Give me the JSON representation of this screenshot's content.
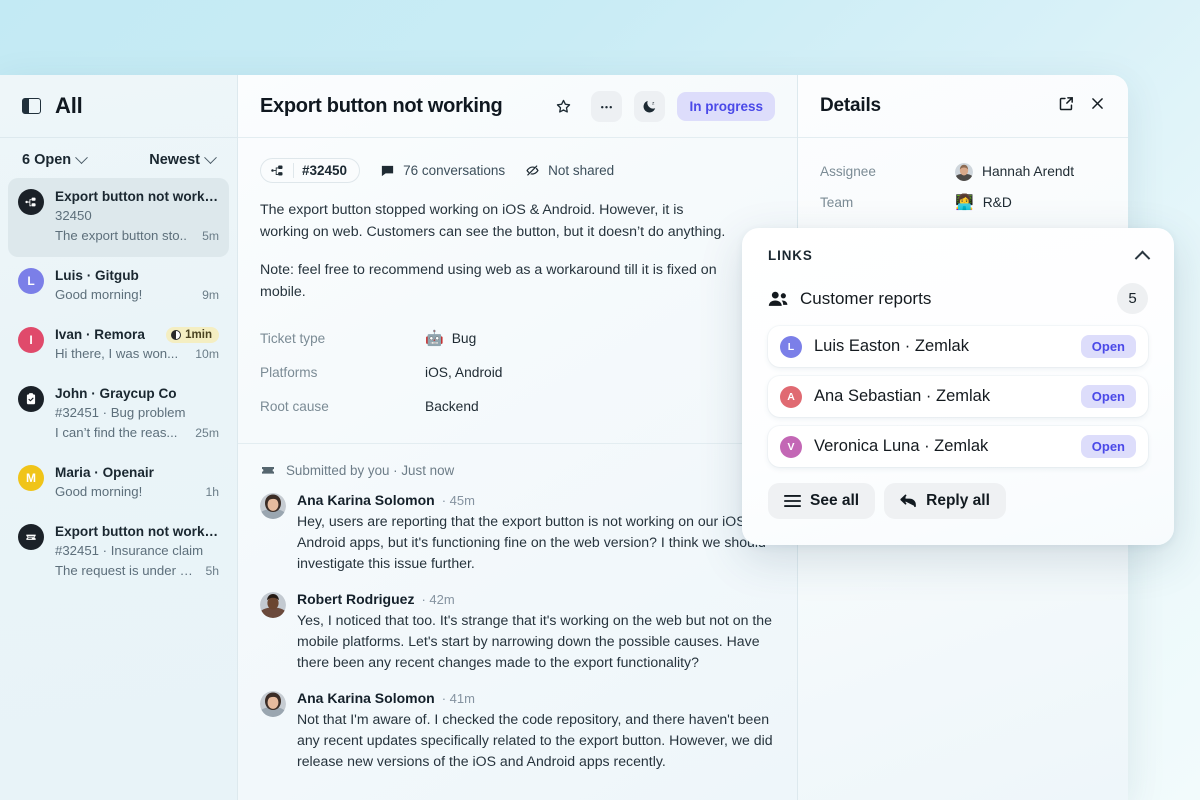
{
  "sidebar": {
    "toggle_icon": "panel-toggle-icon",
    "title": "All",
    "filter": {
      "label": "6 Open",
      "icon": "chevron-down-icon"
    },
    "sort": {
      "label": "Newest",
      "icon": "chevron-down-icon"
    },
    "items": [
      {
        "icon": "sitemap-icon",
        "avatar_type": "icon",
        "avatar_color": "#1b2128",
        "title": "Export button not working",
        "subtitle": "32450",
        "preview": "The export button sto..",
        "time": "5m",
        "active": true,
        "badge": null
      },
      {
        "avatar_type": "initial",
        "initial": "L",
        "avatar_color": "#7b7fe8",
        "title": "Luis · Gitgub",
        "subtitle": null,
        "preview": "Good morning!",
        "time": "9m",
        "active": false,
        "badge": null
      },
      {
        "avatar_type": "initial",
        "initial": "I",
        "avatar_color": "#e04a6b",
        "title": "Ivan · Remora",
        "subtitle": null,
        "preview": "Hi there, I was won...",
        "time": "10m",
        "active": false,
        "badge": "1min"
      },
      {
        "icon": "clipboard-check-icon",
        "avatar_type": "icon",
        "avatar_color": "#1b2128",
        "title": "John · Graycup Co",
        "subtitle": "#32451 · Bug problem",
        "preview": "I can’t find the reas...",
        "time": "25m",
        "active": false,
        "badge": null
      },
      {
        "avatar_type": "initial",
        "initial": "M",
        "avatar_color": "#f0c419",
        "title": "Maria · Openair",
        "subtitle": null,
        "preview": "Good morning!",
        "time": "1h",
        "active": false,
        "badge": null
      },
      {
        "icon": "ticket-icon",
        "avatar_type": "icon",
        "avatar_color": "#1b2128",
        "title": "Export button not working",
        "subtitle": "#32451 · Insurance claim",
        "preview": "The request is under way",
        "time": "5h",
        "active": false,
        "badge": null
      }
    ]
  },
  "main": {
    "title": "Export button not working",
    "actions": [
      {
        "name": "star-icon",
        "label": "Star"
      },
      {
        "name": "more-icon",
        "label": "More"
      },
      {
        "name": "snooze-moon-icon",
        "label": "Snooze"
      }
    ],
    "status": "In progress",
    "meta": {
      "ticket_icon": "sitemap-icon",
      "ticket_id": "#32450",
      "conversations_icon": "chat-icon",
      "conversations": "76 conversations",
      "shared_icon": "eye-off-icon",
      "shared": "Not shared"
    },
    "description": [
      "The export button stopped working on iOS & Android. However, it is working on web. Customers can see the button, but it doesn’t do anything.",
      "Note: feel free to recommend using web as a workaround till it is fixed on mobile."
    ],
    "attributes": [
      {
        "key": "Ticket type",
        "emoji": "🤖",
        "value": "Bug"
      },
      {
        "key": "Platforms",
        "emoji": "",
        "value": "iOS, Android"
      },
      {
        "key": "Root cause",
        "emoji": "",
        "value": "Backend"
      }
    ],
    "submitted": {
      "icon": "ticket-icon",
      "text": "Submitted by you · Just now"
    },
    "messages": [
      {
        "name": "Ana Karina Solomon",
        "time": "· 45m",
        "avatar": "woman-scarf",
        "text": "Hey, users are reporting that the export button is not working on our iOS and Android apps, but it's functioning fine on the web version? I think we should investigate this issue further."
      },
      {
        "name": "Robert Rodriguez",
        "time": "· 42m",
        "avatar": "man-dark",
        "text": "Yes, I noticed that too. It's strange that it's working on the web but not on the mobile platforms. Let's start by narrowing down the possible causes. Have there been any recent changes made to the export functionality?"
      },
      {
        "name": "Ana Karina Solomon",
        "time": "· 41m",
        "avatar": "woman-scarf",
        "text": "Not that I'm aware of. I checked the code repository, and there haven't been any recent updates specifically related to the export button. However, we did release new versions of the iOS and Android apps recently."
      }
    ]
  },
  "details": {
    "title": "Details",
    "expand_icon": "external-link-icon",
    "close_icon": "close-icon",
    "rows": [
      {
        "key": "Assignee",
        "value": "Hannah Arendt",
        "avatar": "man-bald"
      },
      {
        "key": "Team",
        "value": "R&D",
        "emoji": "👩‍💻"
      }
    ]
  },
  "links_card": {
    "heading": "LINKS",
    "collapse_icon": "chevron-up-icon",
    "section": {
      "icon": "people-icon",
      "label": "Customer reports",
      "count": "5"
    },
    "items": [
      {
        "initial": "L",
        "color": "#7b7fe8",
        "name": "Luis Easton · Zemlak",
        "status": "Open"
      },
      {
        "initial": "A",
        "color": "#e06a72",
        "name": "Ana Sebastian · Zemlak",
        "status": "Open"
      },
      {
        "initial": "V",
        "color": "#c367b5",
        "name": "Veronica Luna · Zemlak",
        "status": "Open"
      }
    ],
    "actions": [
      {
        "icon": "list-icon",
        "label": "See all"
      },
      {
        "icon": "reply-icon",
        "label": "Reply all"
      }
    ]
  },
  "colors": {
    "accent": "#4a49e8",
    "accent_bg": "#ddddfb",
    "page_bg": "#c8ecf5",
    "sla_badge": "#f4eec2"
  }
}
